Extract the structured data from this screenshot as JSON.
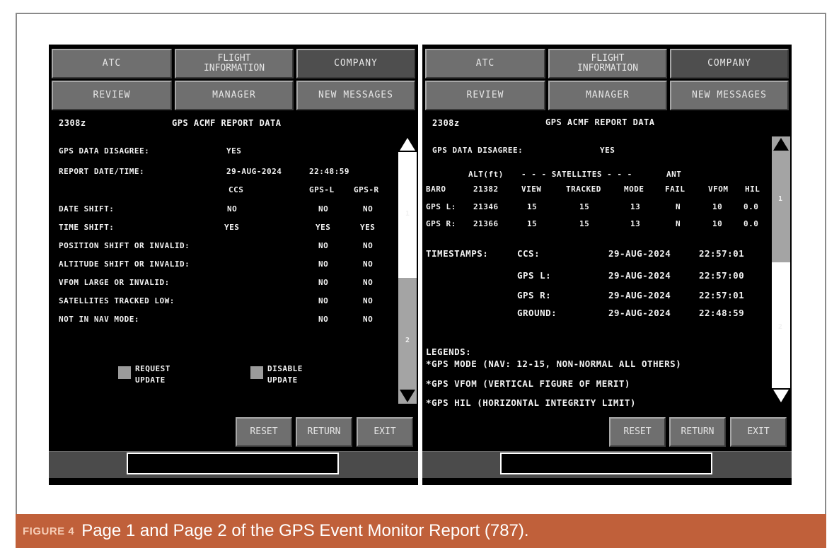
{
  "caption": {
    "figure_label": "FIGURE 4",
    "text": "Page 1 and Page 2 of the GPS Event Monitor Report (787)."
  },
  "nav": {
    "atc": "ATC",
    "flight_info_line1": "FLIGHT",
    "flight_info_line2": "INFORMATION",
    "company": "COMPANY",
    "review": "REVIEW",
    "manager": "MANAGER",
    "new_messages": "NEW MESSAGES"
  },
  "actions": {
    "reset": "RESET",
    "return": "RETURN",
    "exit": "EXIT"
  },
  "page1": {
    "time": "2308z",
    "title": "GPS ACMF REPORT DATA",
    "disagree_label": "GPS DATA DISAGREE:",
    "disagree_value": "YES",
    "report_label": "REPORT DATE/TIME:",
    "report_date": "29-AUG-2024",
    "report_time": "22:48:59",
    "col_ccs": "CCS",
    "col_gpsl": "GPS-L",
    "col_gpsr": "GPS-R",
    "rows": [
      {
        "label": "DATE SHIFT:",
        "ccs": "NO",
        "l": "NO",
        "r": "NO"
      },
      {
        "label": "TIME SHIFT:",
        "ccs": "YES",
        "l": "YES",
        "r": "YES"
      },
      {
        "label": "POSITION SHIFT OR INVALID:",
        "ccs": "",
        "l": "NO",
        "r": "NO"
      },
      {
        "label": "ALTITUDE SHIFT OR INVALID:",
        "ccs": "",
        "l": "NO",
        "r": "NO"
      },
      {
        "label": "VFOM LARGE OR INVALID:",
        "ccs": "",
        "l": "NO",
        "r": "NO"
      },
      {
        "label": "SATELLITES TRACKED LOW:",
        "ccs": "",
        "l": "NO",
        "r": "NO"
      },
      {
        "label": "NOT IN NAV MODE:",
        "ccs": "",
        "l": "NO",
        "r": "NO"
      }
    ],
    "request_line1": "REQUEST",
    "request_line2": "UPDATE",
    "disable_line1": "DISABLE",
    "disable_line2": "UPDATE",
    "page_1": "1",
    "page_2": "2"
  },
  "page2": {
    "time": "2308z",
    "title": "GPS ACMF REPORT DATA",
    "disagree_label": "GPS DATA DISAGREE:",
    "disagree_value": "YES",
    "hdr_alt": "ALT(ft)",
    "hdr_sat": "- - - SATELLITES - - -",
    "hdr_ant": "ANT",
    "hdr_baro": "BARO",
    "baro_alt": "21382",
    "hdr_view": "VIEW",
    "hdr_tracked": "TRACKED",
    "hdr_mode": "MODE",
    "hdr_fail": "FAIL",
    "hdr_vfom": "VFOM",
    "hdr_hil": "HIL",
    "gps_rows": [
      {
        "label": "GPS L:",
        "alt": "21346",
        "view": "15",
        "tracked": "15",
        "mode": "13",
        "fail": "N",
        "vfom": "10",
        "hil": "0.0"
      },
      {
        "label": "GPS R:",
        "alt": "21366",
        "view": "15",
        "tracked": "15",
        "mode": "13",
        "fail": "N",
        "vfom": "10",
        "hil": "0.0"
      }
    ],
    "timestamps_label": "TIMESTAMPS:",
    "timestamps": [
      {
        "label": "CCS:",
        "date": "29-AUG-2024",
        "time": "22:57:01"
      },
      {
        "label": "GPS L:",
        "date": "29-AUG-2024",
        "time": "22:57:00"
      },
      {
        "label": "GPS R:",
        "date": "29-AUG-2024",
        "time": "22:57:01"
      },
      {
        "label": "GROUND:",
        "date": "29-AUG-2024",
        "time": "22:48:59"
      }
    ],
    "legends_label": "LEGENDS:",
    "legend_1": "*GPS MODE (NAV: 12-15, NON-NORMAL ALL OTHERS)",
    "legend_2": "*GPS VFOM (VERTICAL FIGURE OF MERIT)",
    "legend_3": "*GPS HIL (HORIZONTAL INTEGRITY LIMIT)",
    "page_1": "1",
    "page_2": "2"
  }
}
